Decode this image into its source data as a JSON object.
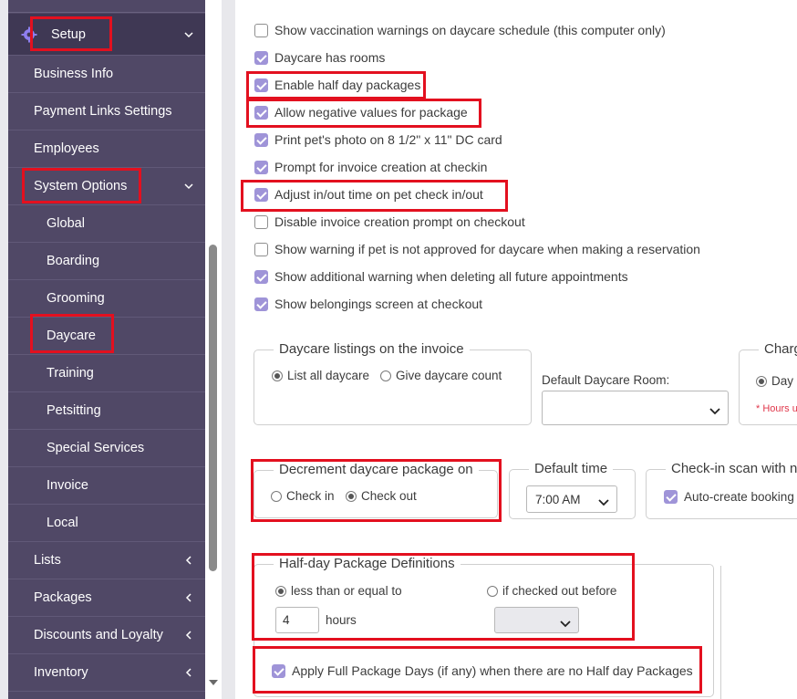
{
  "sidebar": {
    "setup": "Setup",
    "items": [
      {
        "label": "Business Info"
      },
      {
        "label": "Payment Links Settings"
      },
      {
        "label": "Employees"
      },
      {
        "label": "System Options"
      },
      {
        "label": "Global"
      },
      {
        "label": "Boarding"
      },
      {
        "label": "Grooming"
      },
      {
        "label": "Daycare"
      },
      {
        "label": "Training"
      },
      {
        "label": "Petsitting"
      },
      {
        "label": "Special Services"
      },
      {
        "label": "Invoice"
      },
      {
        "label": "Local"
      },
      {
        "label": "Lists"
      },
      {
        "label": "Packages"
      },
      {
        "label": "Discounts and Loyalty"
      },
      {
        "label": "Inventory"
      }
    ]
  },
  "options": [
    {
      "label": "Show vaccination warnings on daycare schedule (this computer only)",
      "checked": false
    },
    {
      "label": "Daycare has rooms",
      "checked": true
    },
    {
      "label": "Enable half day packages",
      "checked": true
    },
    {
      "label": "Allow negative values for package",
      "checked": true
    },
    {
      "label": "Print pet's photo on 8 1/2\" x 11\" DC card",
      "checked": true
    },
    {
      "label": "Prompt for invoice creation at checkin",
      "checked": true
    },
    {
      "label": "Adjust in/out time on pet check in/out",
      "checked": true
    },
    {
      "label": "Disable invoice creation prompt on checkout",
      "checked": false
    },
    {
      "label": "Show warning if pet is not approved for daycare when making a reservation",
      "checked": false
    },
    {
      "label": "Show additional warning when deleting all future appointments",
      "checked": true
    },
    {
      "label": "Show belongings screen at checkout",
      "checked": true
    }
  ],
  "listings": {
    "legend": "Daycare listings on the invoice",
    "opt1": "List all daycare",
    "opt2": "Give daycare count",
    "selected": "List all daycare"
  },
  "default_room": {
    "label": "Default Daycare Room:",
    "value": ""
  },
  "charge": {
    "legend": "Charg",
    "opt1": "Day",
    "note": "* Hours u"
  },
  "decrement": {
    "legend": "Decrement daycare package on",
    "opt1": "Check in",
    "opt2": "Check out",
    "selected": "Check out"
  },
  "default_time": {
    "legend": "Default time",
    "value": "7:00 AM"
  },
  "checkin_scan": {
    "legend": "Check-in scan with n",
    "opt1": "Auto-create booking",
    "checked": true
  },
  "half_day": {
    "legend": "Half-day Package Definitions",
    "opt1": "less than or equal to",
    "opt2": "if checked out before",
    "selected": "less than or equal to",
    "hours_value": "4",
    "hours_label": "hours",
    "before_value": ""
  },
  "apply_full": {
    "label": "Apply Full Package Days (if any) when there are no Half day Packages",
    "checked": true
  },
  "colors": {
    "sidebar_bg": "#504866",
    "checkbox_on": "#9f94d8",
    "highlight": "#e3101f"
  }
}
